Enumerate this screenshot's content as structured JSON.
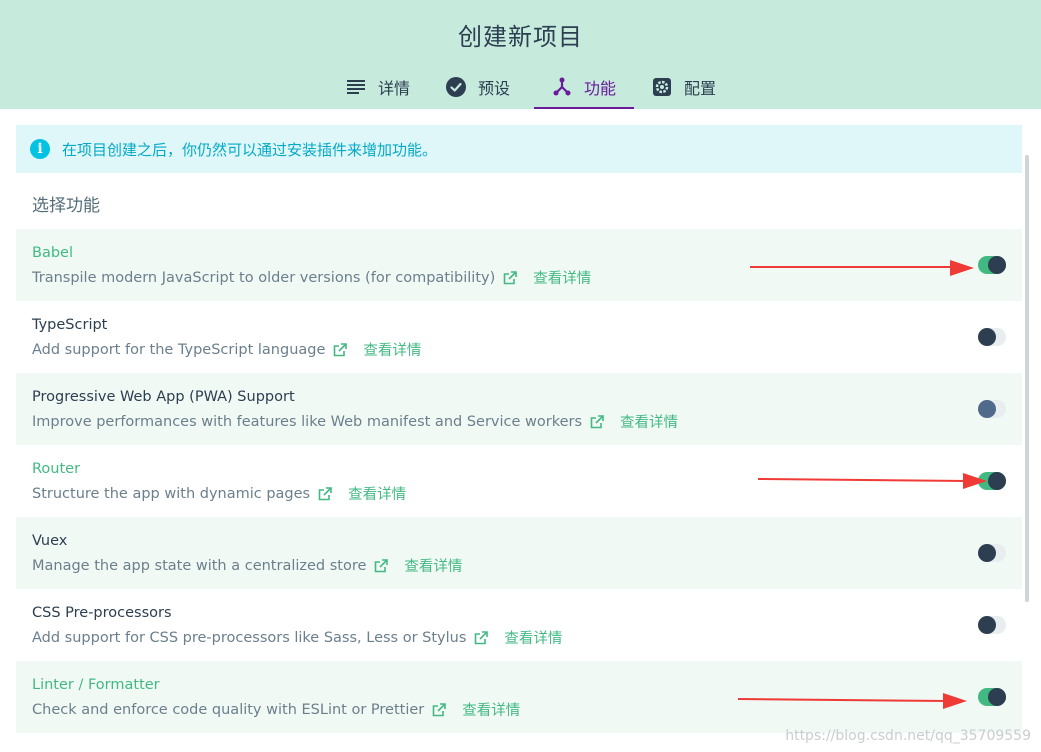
{
  "window": {
    "title": "创建新项目"
  },
  "tabs": [
    {
      "label": "详情",
      "icon": "list-icon"
    },
    {
      "label": "预设",
      "icon": "check-circle-icon"
    },
    {
      "label": "功能",
      "icon": "fork-icon",
      "active": true
    },
    {
      "label": "配置",
      "icon": "gear-icon"
    }
  ],
  "info_banner": {
    "text": "在项目创建之后，你仍然可以通过安装插件来增加功能。"
  },
  "section_title": "选择功能",
  "more_info_label": "查看详情",
  "features": [
    {
      "name": "Babel",
      "description": "Transpile modern JavaScript to older versions (for compatibility)",
      "enabled": true
    },
    {
      "name": "TypeScript",
      "description": "Add support for the TypeScript language",
      "enabled": false
    },
    {
      "name": "Progressive Web App (PWA) Support",
      "description": "Improve performances with features like Web manifest and Service workers",
      "enabled": false
    },
    {
      "name": "Router",
      "description": "Structure the app with dynamic pages",
      "enabled": true
    },
    {
      "name": "Vuex",
      "description": "Manage the app state with a centralized store",
      "enabled": false
    },
    {
      "name": "CSS Pre-processors",
      "description": "Add support for CSS pre-processors like Sass, Less or Stylus",
      "enabled": false
    },
    {
      "name": "Linter / Formatter",
      "description": "Check and enforce code quality with ESLint or Prettier",
      "enabled": true
    }
  ],
  "watermark": "https://blog.csdn.net/qq_35709559",
  "colors": {
    "header_bg": "#c6eadc",
    "accent_green": "#42b983",
    "active_tab": "#6a1b9a",
    "info_bg": "#e0f7fa",
    "info_text": "#03a9c7",
    "annotation_arrow": "#f03a36"
  }
}
